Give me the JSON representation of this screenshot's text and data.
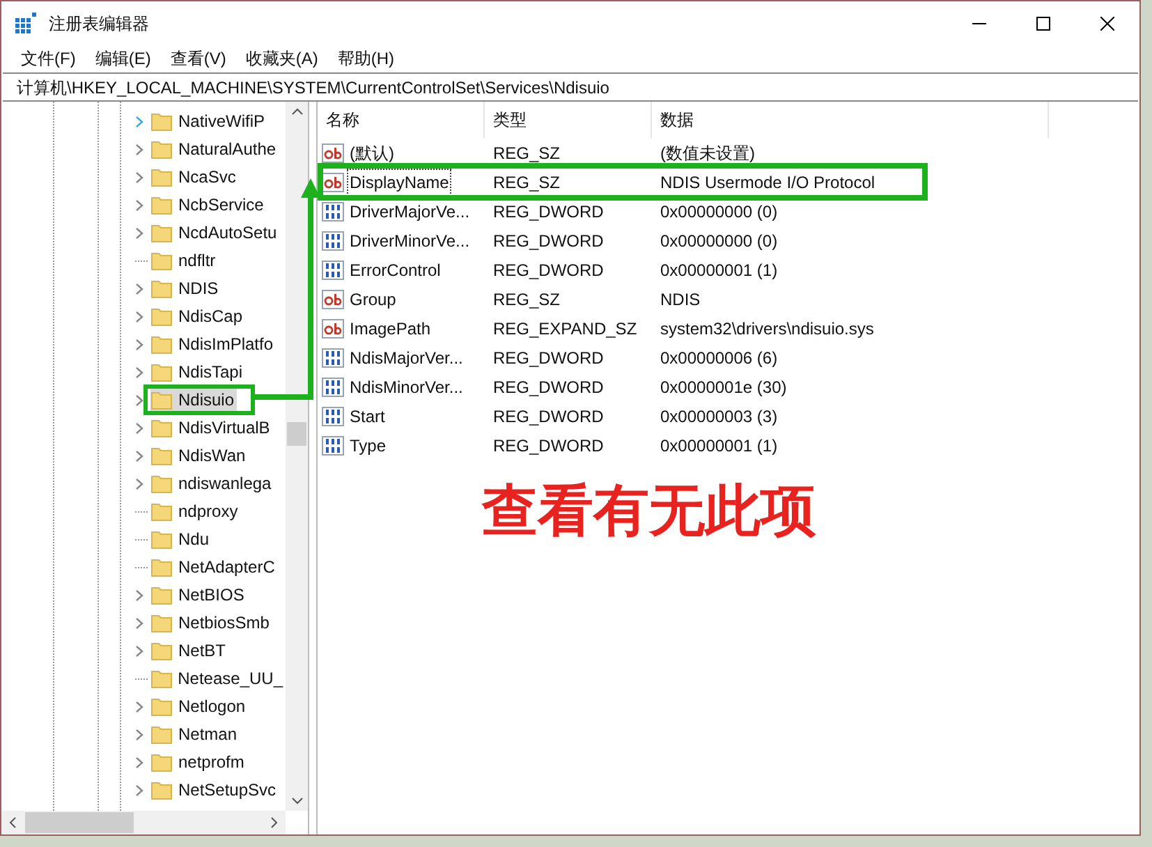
{
  "window": {
    "title": "注册表编辑器"
  },
  "menu": [
    "文件(F)",
    "编辑(E)",
    "查看(V)",
    "收藏夹(A)",
    "帮助(H)"
  ],
  "address": "计算机\\HKEY_LOCAL_MACHINE\\SYSTEM\\CurrentControlSet\\Services\\Ndisuio",
  "tree": {
    "items": [
      {
        "label": "NativeWifiP",
        "expandable": true,
        "selected": false
      },
      {
        "label": "NaturalAuthe",
        "expandable": true,
        "selected": false
      },
      {
        "label": "NcaSvc",
        "expandable": true,
        "selected": false
      },
      {
        "label": "NcbService",
        "expandable": true,
        "selected": false
      },
      {
        "label": "NcdAutoSetu",
        "expandable": true,
        "selected": false
      },
      {
        "label": "ndfltr",
        "expandable": false,
        "selected": false
      },
      {
        "label": "NDIS",
        "expandable": true,
        "selected": false
      },
      {
        "label": "NdisCap",
        "expandable": true,
        "selected": false
      },
      {
        "label": "NdisImPlatfo",
        "expandable": true,
        "selected": false
      },
      {
        "label": "NdisTapi",
        "expandable": true,
        "selected": false
      },
      {
        "label": "Ndisuio",
        "expandable": true,
        "selected": true
      },
      {
        "label": "NdisVirtualB",
        "expandable": true,
        "selected": false
      },
      {
        "label": "NdisWan",
        "expandable": true,
        "selected": false
      },
      {
        "label": "ndiswanlega",
        "expandable": true,
        "selected": false
      },
      {
        "label": "ndproxy",
        "expandable": false,
        "selected": false
      },
      {
        "label": "Ndu",
        "expandable": false,
        "selected": false
      },
      {
        "label": "NetAdapterC",
        "expandable": false,
        "selected": false
      },
      {
        "label": "NetBIOS",
        "expandable": true,
        "selected": false
      },
      {
        "label": "NetbiosSmb",
        "expandable": true,
        "selected": false
      },
      {
        "label": "NetBT",
        "expandable": true,
        "selected": false
      },
      {
        "label": "Netease_UU_",
        "expandable": false,
        "selected": false
      },
      {
        "label": "Netlogon",
        "expandable": true,
        "selected": false
      },
      {
        "label": "Netman",
        "expandable": true,
        "selected": false
      },
      {
        "label": "netprofm",
        "expandable": true,
        "selected": false
      },
      {
        "label": "NetSetupSvc",
        "expandable": true,
        "selected": false
      }
    ]
  },
  "values": {
    "columns": [
      "名称",
      "类型",
      "数据"
    ],
    "rows": [
      {
        "kind": "sz",
        "name": "(默认)",
        "type": "REG_SZ",
        "data": "(数值未设置)",
        "focused": false
      },
      {
        "kind": "sz",
        "name": "DisplayName",
        "type": "REG_SZ",
        "data": "NDIS Usermode I/O Protocol",
        "focused": true
      },
      {
        "kind": "dword",
        "name": "DriverMajorVe...",
        "type": "REG_DWORD",
        "data": "0x00000000 (0)",
        "focused": false
      },
      {
        "kind": "dword",
        "name": "DriverMinorVe...",
        "type": "REG_DWORD",
        "data": "0x00000000 (0)",
        "focused": false
      },
      {
        "kind": "dword",
        "name": "ErrorControl",
        "type": "REG_DWORD",
        "data": "0x00000001 (1)",
        "focused": false
      },
      {
        "kind": "sz",
        "name": "Group",
        "type": "REG_SZ",
        "data": "NDIS",
        "focused": false
      },
      {
        "kind": "sz",
        "name": "ImagePath",
        "type": "REG_EXPAND_SZ",
        "data": "system32\\drivers\\ndisuio.sys",
        "focused": false
      },
      {
        "kind": "dword",
        "name": "NdisMajorVer...",
        "type": "REG_DWORD",
        "data": "0x00000006 (6)",
        "focused": false
      },
      {
        "kind": "dword",
        "name": "NdisMinorVer...",
        "type": "REG_DWORD",
        "data": "0x0000001e (30)",
        "focused": false
      },
      {
        "kind": "dword",
        "name": "Start",
        "type": "REG_DWORD",
        "data": "0x00000003 (3)",
        "focused": false
      },
      {
        "kind": "dword",
        "name": "Type",
        "type": "REG_DWORD",
        "data": "0x00000001 (1)",
        "focused": false
      }
    ]
  },
  "annotation": {
    "text": "查看有无此项"
  }
}
